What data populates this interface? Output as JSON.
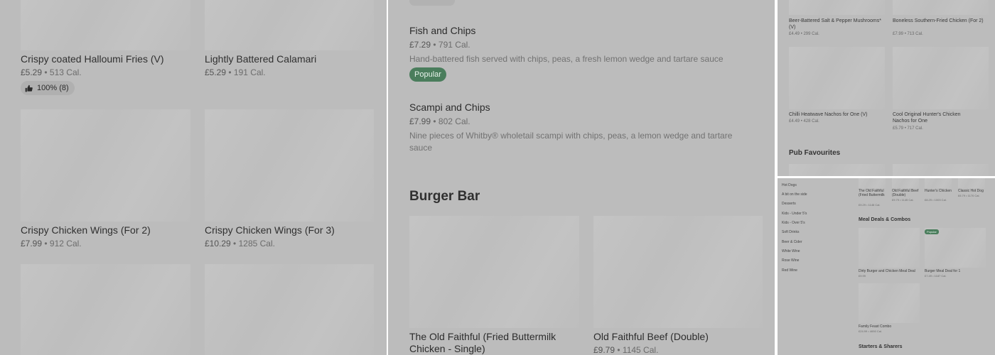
{
  "colors": {
    "overlay": "#bcbcbc",
    "popular_badge": "#4a7d5c"
  },
  "left": {
    "items": [
      {
        "name": "Crispy coated Halloumi Fries (V)",
        "price": "£5.29",
        "cal": "513 Cal.",
        "rating": "100% (8)"
      },
      {
        "name": "Lightly Battered Calamari",
        "price": "£5.29",
        "cal": "191 Cal."
      },
      {
        "name": "Crispy Chicken Wings (For 2)",
        "price": "£7.99",
        "cal": "912 Cal."
      },
      {
        "name": "Crispy Chicken Wings (For 3)",
        "price": "£10.29",
        "cal": "1285 Cal."
      }
    ],
    "separator": "•"
  },
  "middle": {
    "items": [
      {
        "name": "Fish and Chips",
        "price": "£7.29",
        "cal": "791 Cal.",
        "description": "Hand-battered fish served with chips, peas, a fresh lemon wedge and tartare sauce",
        "badge": "Popular"
      },
      {
        "name": "Scampi and Chips",
        "price": "£7.99",
        "cal": "802 Cal.",
        "description": "Nine pieces of Whitby® wholetail scampi with chips, peas, a lemon wedge and tartare sauce"
      }
    ],
    "section_title": "Burger Bar",
    "cards": [
      {
        "name": "The Old Faithful (Fried Buttermilk Chicken - Single)"
      },
      {
        "name": "Old Faithful Beef (Double)",
        "price": "£9.79",
        "cal": "1145 Cal."
      }
    ]
  },
  "top_right": {
    "items": [
      {
        "name": "Beer-Battered Salt & Pepper Mushrooms* (V)",
        "price": "£4.49",
        "cal": "299 Cal."
      },
      {
        "name": "Boneless Southern-Fried Chicken (For 2)",
        "price": "£7.99",
        "cal": "713 Cal."
      },
      {
        "name": "Chilli Heatwave Nachos for One (V)",
        "price": "£4.49",
        "cal": "428 Cal."
      },
      {
        "name": "Cool Original Hunter's Chicken Nachos for One",
        "price": "£5.79",
        "cal": "717 Cal."
      }
    ],
    "section_title": "Pub Favourites"
  },
  "bottom_right": {
    "sidebar": [
      "Hot Dogs",
      "A bit on the side",
      "Desserts",
      "Kids - Under 5's",
      "Kids - Over 5's",
      "Soft Drinks",
      "Beer & Cider",
      "White Wine",
      "Rose Wine",
      "Red Wine"
    ],
    "top_items": [
      {
        "name": "The Old Faithful (Fried Buttermilk",
        "price": "£9.29",
        "cal": "1146 Cal."
      },
      {
        "name": "Old Faithful Beef (Double)",
        "price": "£9.79",
        "cal": "1145 Cal."
      },
      {
        "name": "Hunter's Chicken",
        "price": "£8.29",
        "cal": "1003 Cal."
      },
      {
        "name": "Classic Hot Dog",
        "price": "£6.79",
        "cal": "1170 Cal."
      }
    ],
    "meal_title": "Meal Deals & Combos",
    "meal_items": [
      {
        "name": "Dirty Burger and Chicken Meal Deal",
        "price": "£9.99"
      },
      {
        "name": "Burger Meal Deal for 1",
        "price": "£7.49",
        "cal": "1187 Cal.",
        "badge": "Popular"
      },
      {
        "name": "Family Feast Combo",
        "price": "£24.99",
        "cal": "4650 Cal."
      }
    ],
    "starters_title": "Starters & Sharers"
  }
}
